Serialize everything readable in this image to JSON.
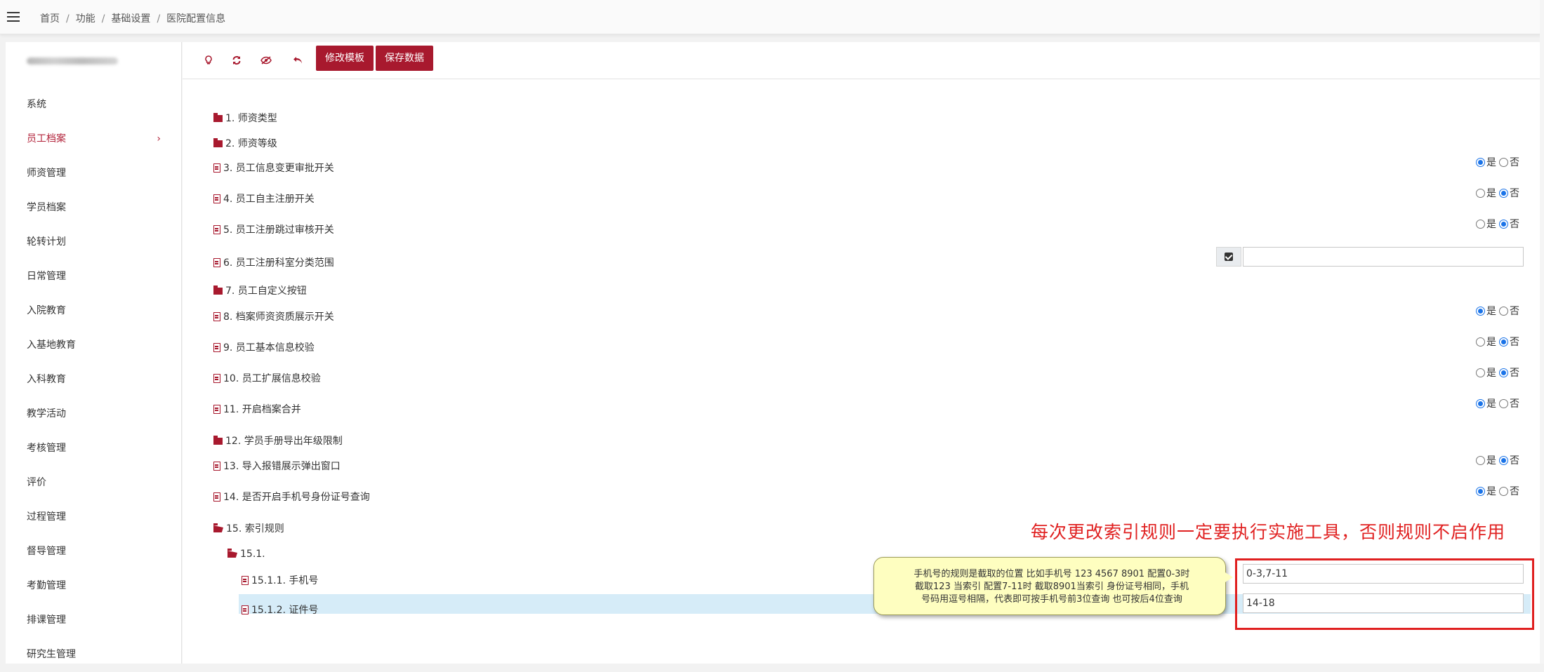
{
  "topbar": {
    "menu_icon": "hamburger-icon",
    "breadcrumb": [
      "首页",
      "功能",
      "基础设置",
      "医院配置信息"
    ],
    "separator": "/"
  },
  "sidebar": {
    "items": [
      {
        "label": "系统"
      },
      {
        "label": "员工档案",
        "active": true,
        "arrow": "›"
      },
      {
        "label": "师资管理"
      },
      {
        "label": "学员档案"
      },
      {
        "label": "轮转计划"
      },
      {
        "label": "日常管理"
      },
      {
        "label": "入院教育"
      },
      {
        "label": "入基地教育"
      },
      {
        "label": "入科教育"
      },
      {
        "label": "教学活动"
      },
      {
        "label": "考核管理"
      },
      {
        "label": "评价"
      },
      {
        "label": "过程管理"
      },
      {
        "label": "督导管理"
      },
      {
        "label": "考勤管理"
      },
      {
        "label": "排课管理"
      },
      {
        "label": "研究生管理"
      }
    ]
  },
  "toolbar": {
    "icons": [
      "lightbulb-icon",
      "refresh-icon",
      "eye-slash-icon",
      "undo-icon"
    ],
    "edit_template_label": "修改模板",
    "save_data_label": "保存数据"
  },
  "radio_labels": {
    "yes": "是",
    "no": "否"
  },
  "tree": [
    {
      "id": "1",
      "label": "1. 师资类型",
      "kind": "folder"
    },
    {
      "id": "2",
      "label": "2. 师资等级",
      "kind": "folder"
    },
    {
      "id": "3",
      "label": "3. 员工信息变更审批开关",
      "kind": "file",
      "value": "是"
    },
    {
      "id": "4",
      "label": "4. 员工自主注册开关",
      "kind": "file",
      "value": "否"
    },
    {
      "id": "5",
      "label": "5. 员工注册跳过审核开关",
      "kind": "file",
      "value": "否"
    },
    {
      "id": "6",
      "label": "6. 员工注册科室分类范围",
      "kind": "file",
      "input": ""
    },
    {
      "id": "7",
      "label": "7. 员工自定义按钮",
      "kind": "folder"
    },
    {
      "id": "8",
      "label": "8. 档案师资资质展示开关",
      "kind": "file",
      "value": "是"
    },
    {
      "id": "9",
      "label": "9. 员工基本信息校验",
      "kind": "file",
      "value": "否"
    },
    {
      "id": "10",
      "label": "10. 员工扩展信息校验",
      "kind": "file",
      "value": "否"
    },
    {
      "id": "11",
      "label": "11. 开启档案合并",
      "kind": "file",
      "value": "是"
    },
    {
      "id": "12",
      "label": "12. 学员手册导出年级限制",
      "kind": "folder"
    },
    {
      "id": "13",
      "label": "13. 导入报错展示弹出窗口",
      "kind": "file",
      "value": "否"
    },
    {
      "id": "14",
      "label": "14. 是否开启手机号身份证号查询",
      "kind": "file",
      "value": "是"
    },
    {
      "id": "15",
      "label": "15. 索引规则",
      "kind": "folder-open"
    },
    {
      "id": "15.1",
      "label": "15.1.",
      "kind": "folder-open"
    },
    {
      "id": "15.1.1",
      "label": "15.1.1. 手机号",
      "kind": "file",
      "input": "0-3,7-11"
    },
    {
      "id": "15.1.2",
      "label": "15.1.2. 证件号",
      "kind": "file",
      "input": "14-18",
      "selected": true
    }
  ],
  "annotation": {
    "text": "每次更改索引规则一定要执行实施工具，否则规则不启作用",
    "color": "#e02020"
  },
  "tooltip": {
    "lines": [
      "手机号的规则是截取的位置 比如手机号 123 4567 8901 配置0-3时",
      "截取123 当索引 配置7-11时 截取8901当索引 身份证号相同，手机",
      "号码用逗号相隔，代表即可按手机号前3位查询 也可按后4位查询"
    ]
  },
  "colors": {
    "brand": "#a8192e",
    "radio_on": "#1a73e8",
    "selected_row": "#d6ecf8"
  }
}
